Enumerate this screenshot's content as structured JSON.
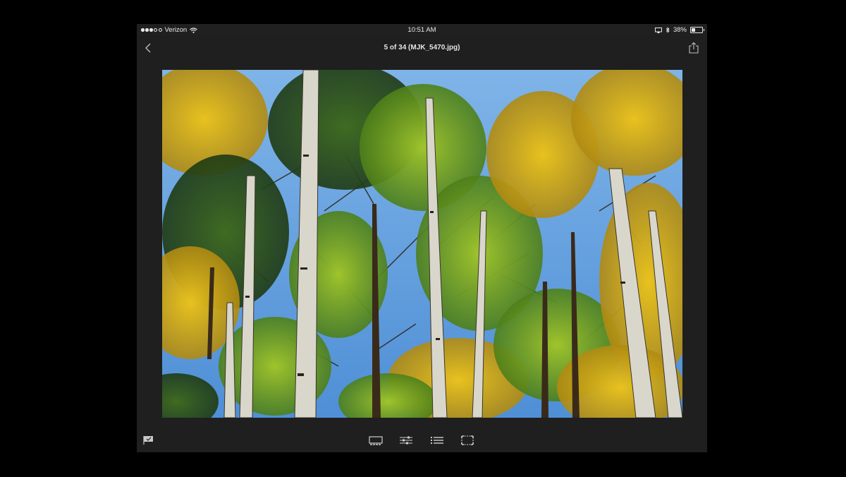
{
  "status_bar": {
    "carrier": "Verizon",
    "signal_bars": 3,
    "signal_total": 5,
    "time": "10:51 AM",
    "battery_text": "38%",
    "battery_level": 0.38
  },
  "nav": {
    "title": "5 of 34 (MJK_5470.jpg)",
    "back_icon": "chevron-left-icon",
    "share_icon": "share-icon"
  },
  "photo": {
    "subject": "aspen trees against blue sky"
  },
  "toolbar": {
    "items": [
      "filmstrip-icon",
      "adjust-sliders-icon",
      "info-list-icon",
      "crop-icon"
    ],
    "flag_icon": "flag-icon"
  },
  "colors": {
    "background": "#000000",
    "device": "#1f1f1f",
    "text": "#e5e5e5",
    "sky": "#5f9ede"
  }
}
